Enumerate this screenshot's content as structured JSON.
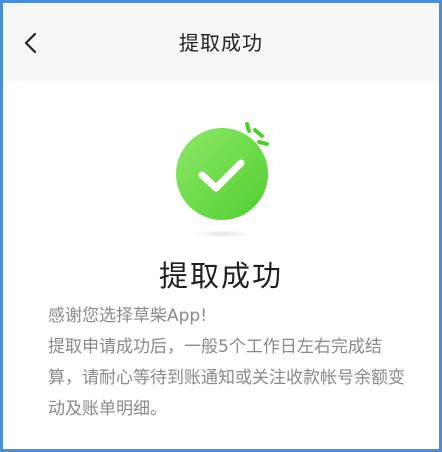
{
  "navbar": {
    "title": "提取成功",
    "back_icon": "chevron-left-icon"
  },
  "status": {
    "icon": "check-circle-icon",
    "accent_color": "#5fd53a",
    "title": "提取成功"
  },
  "message": {
    "line1": "感谢您选择草柴App!",
    "line2": "提取申请成功后，一般5个工作日左右完成结算，请耐心等待到账通知或关注收款帐号余额变动及账单明细。"
  }
}
